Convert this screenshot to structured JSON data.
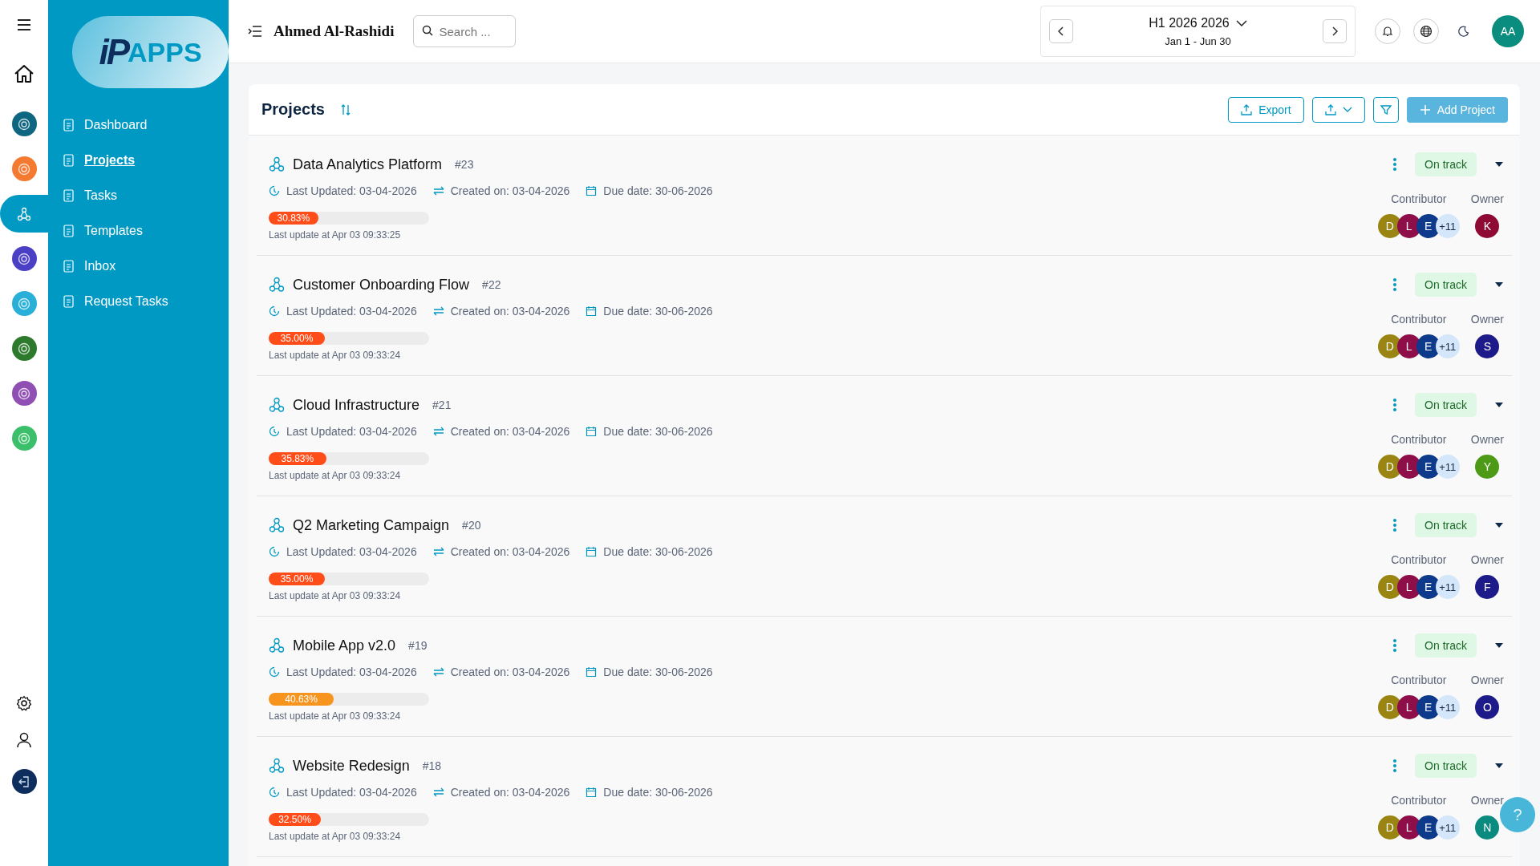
{
  "logo": {
    "mark": "iP",
    "text": "APPS"
  },
  "rail": [
    {
      "selected": false,
      "color": "#0e6680"
    },
    {
      "selected": false,
      "color": "#f47a32"
    },
    {
      "selected": true,
      "color": "#0099c4"
    },
    {
      "selected": false,
      "color": "#4b3fc6"
    },
    {
      "selected": false,
      "color": "#2ab0d8"
    },
    {
      "selected": false,
      "color": "#2d7a2d"
    },
    {
      "selected": false,
      "color": "#8f4fb3"
    },
    {
      "selected": false,
      "color": "#3cbf6a"
    }
  ],
  "sidebar": {
    "items": [
      {
        "label": "Dashboard",
        "selected": false
      },
      {
        "label": "Projects",
        "selected": true
      },
      {
        "label": "Tasks",
        "selected": false
      },
      {
        "label": "Templates",
        "selected": false
      },
      {
        "label": "Inbox",
        "selected": false
      },
      {
        "label": "Request Tasks",
        "selected": false
      }
    ]
  },
  "topbar": {
    "user": "Ahmed Al-Rashidi",
    "search": {
      "placeholder": "Search ..."
    },
    "period": {
      "title": "H1 2026 2026",
      "range": "Jan 1 - Jun 30"
    },
    "avatar": "AA"
  },
  "page": {
    "title": "Projects",
    "export": "Export",
    "add": "Add Project"
  },
  "projects": [
    {
      "name": "Data Analytics Platform",
      "number": "#23",
      "updated": "Last Updated: 03-04-2026",
      "created": "Created on: 03-04-2026",
      "due": "Due date: 30-06-2026",
      "percent": "30.83%",
      "level": 0.3083,
      "last_update": "Last update at Apr 03 09:33:25",
      "status": "On track",
      "contributor_label": "Contributor",
      "owner_label": "Owner",
      "contributors": [
        {
          "initial": "D",
          "color": "#9a8412"
        },
        {
          "initial": "L",
          "color": "#8e0e4a"
        },
        {
          "initial": "E",
          "color": "#0e3a8c"
        }
      ],
      "more": "+11",
      "owner": {
        "initial": "K",
        "color": "#8e0a34"
      }
    },
    {
      "name": "Customer Onboarding Flow",
      "number": "#22",
      "updated": "Last Updated: 03-04-2026",
      "created": "Created on: 03-04-2026",
      "due": "Due date: 30-06-2026",
      "percent": "35.00%",
      "level": 0.35,
      "last_update": "Last update at Apr 03 09:33:24",
      "status": "On track",
      "contributor_label": "Contributor",
      "owner_label": "Owner",
      "contributors": [
        {
          "initial": "D",
          "color": "#9a8412"
        },
        {
          "initial": "L",
          "color": "#8e0e4a"
        },
        {
          "initial": "E",
          "color": "#0e3a8c"
        }
      ],
      "more": "+11",
      "owner": {
        "initial": "S",
        "color": "#1d1a8a"
      }
    },
    {
      "name": "Cloud Infrastructure",
      "number": "#21",
      "updated": "Last Updated: 03-04-2026",
      "created": "Created on: 03-04-2026",
      "due": "Due date: 30-06-2026",
      "percent": "35.83%",
      "level": 0.3583,
      "last_update": "Last update at Apr 03 09:33:24",
      "status": "On track",
      "contributor_label": "Contributor",
      "owner_label": "Owner",
      "contributors": [
        {
          "initial": "D",
          "color": "#9a8412"
        },
        {
          "initial": "L",
          "color": "#8e0e4a"
        },
        {
          "initial": "E",
          "color": "#0e3a8c"
        }
      ],
      "more": "+11",
      "owner": {
        "initial": "Y",
        "color": "#4c9a16"
      }
    },
    {
      "name": "Q2 Marketing Campaign",
      "number": "#20",
      "updated": "Last Updated: 03-04-2026",
      "created": "Created on: 03-04-2026",
      "due": "Due date: 30-06-2026",
      "percent": "35.00%",
      "level": 0.35,
      "last_update": "Last update at Apr 03 09:33:24",
      "status": "On track",
      "contributor_label": "Contributor",
      "owner_label": "Owner",
      "contributors": [
        {
          "initial": "D",
          "color": "#9a8412"
        },
        {
          "initial": "L",
          "color": "#8e0e4a"
        },
        {
          "initial": "E",
          "color": "#0e3a8c"
        }
      ],
      "more": "+11",
      "owner": {
        "initial": "F",
        "color": "#1d1a8a"
      }
    },
    {
      "name": "Mobile App v2.0",
      "number": "#19",
      "updated": "Last Updated: 03-04-2026",
      "created": "Created on: 03-04-2026",
      "due": "Due date: 30-06-2026",
      "percent": "40.63%",
      "level": 0.4063,
      "last_update": "Last update at Apr 03 09:33:24",
      "status": "On track",
      "contributor_label": "Contributor",
      "owner_label": "Owner",
      "contributors": [
        {
          "initial": "D",
          "color": "#9a8412"
        },
        {
          "initial": "L",
          "color": "#8e0e4a"
        },
        {
          "initial": "E",
          "color": "#0e3a8c"
        }
      ],
      "more": "+11",
      "owner": {
        "initial": "O",
        "color": "#1d1a8a"
      }
    },
    {
      "name": "Website Redesign",
      "number": "#18",
      "updated": "Last Updated: 03-04-2026",
      "created": "Created on: 03-04-2026",
      "due": "Due date: 30-06-2026",
      "percent": "32.50%",
      "level": 0.325,
      "last_update": "Last update at Apr 03 09:33:24",
      "status": "On track",
      "contributor_label": "Contributor",
      "owner_label": "Owner",
      "contributors": [
        {
          "initial": "D",
          "color": "#9a8412"
        },
        {
          "initial": "L",
          "color": "#8e0e4a"
        },
        {
          "initial": "E",
          "color": "#0e3a8c"
        }
      ],
      "more": "+11",
      "owner": {
        "initial": "N",
        "color": "#0b8a80"
      }
    }
  ],
  "help": "?"
}
